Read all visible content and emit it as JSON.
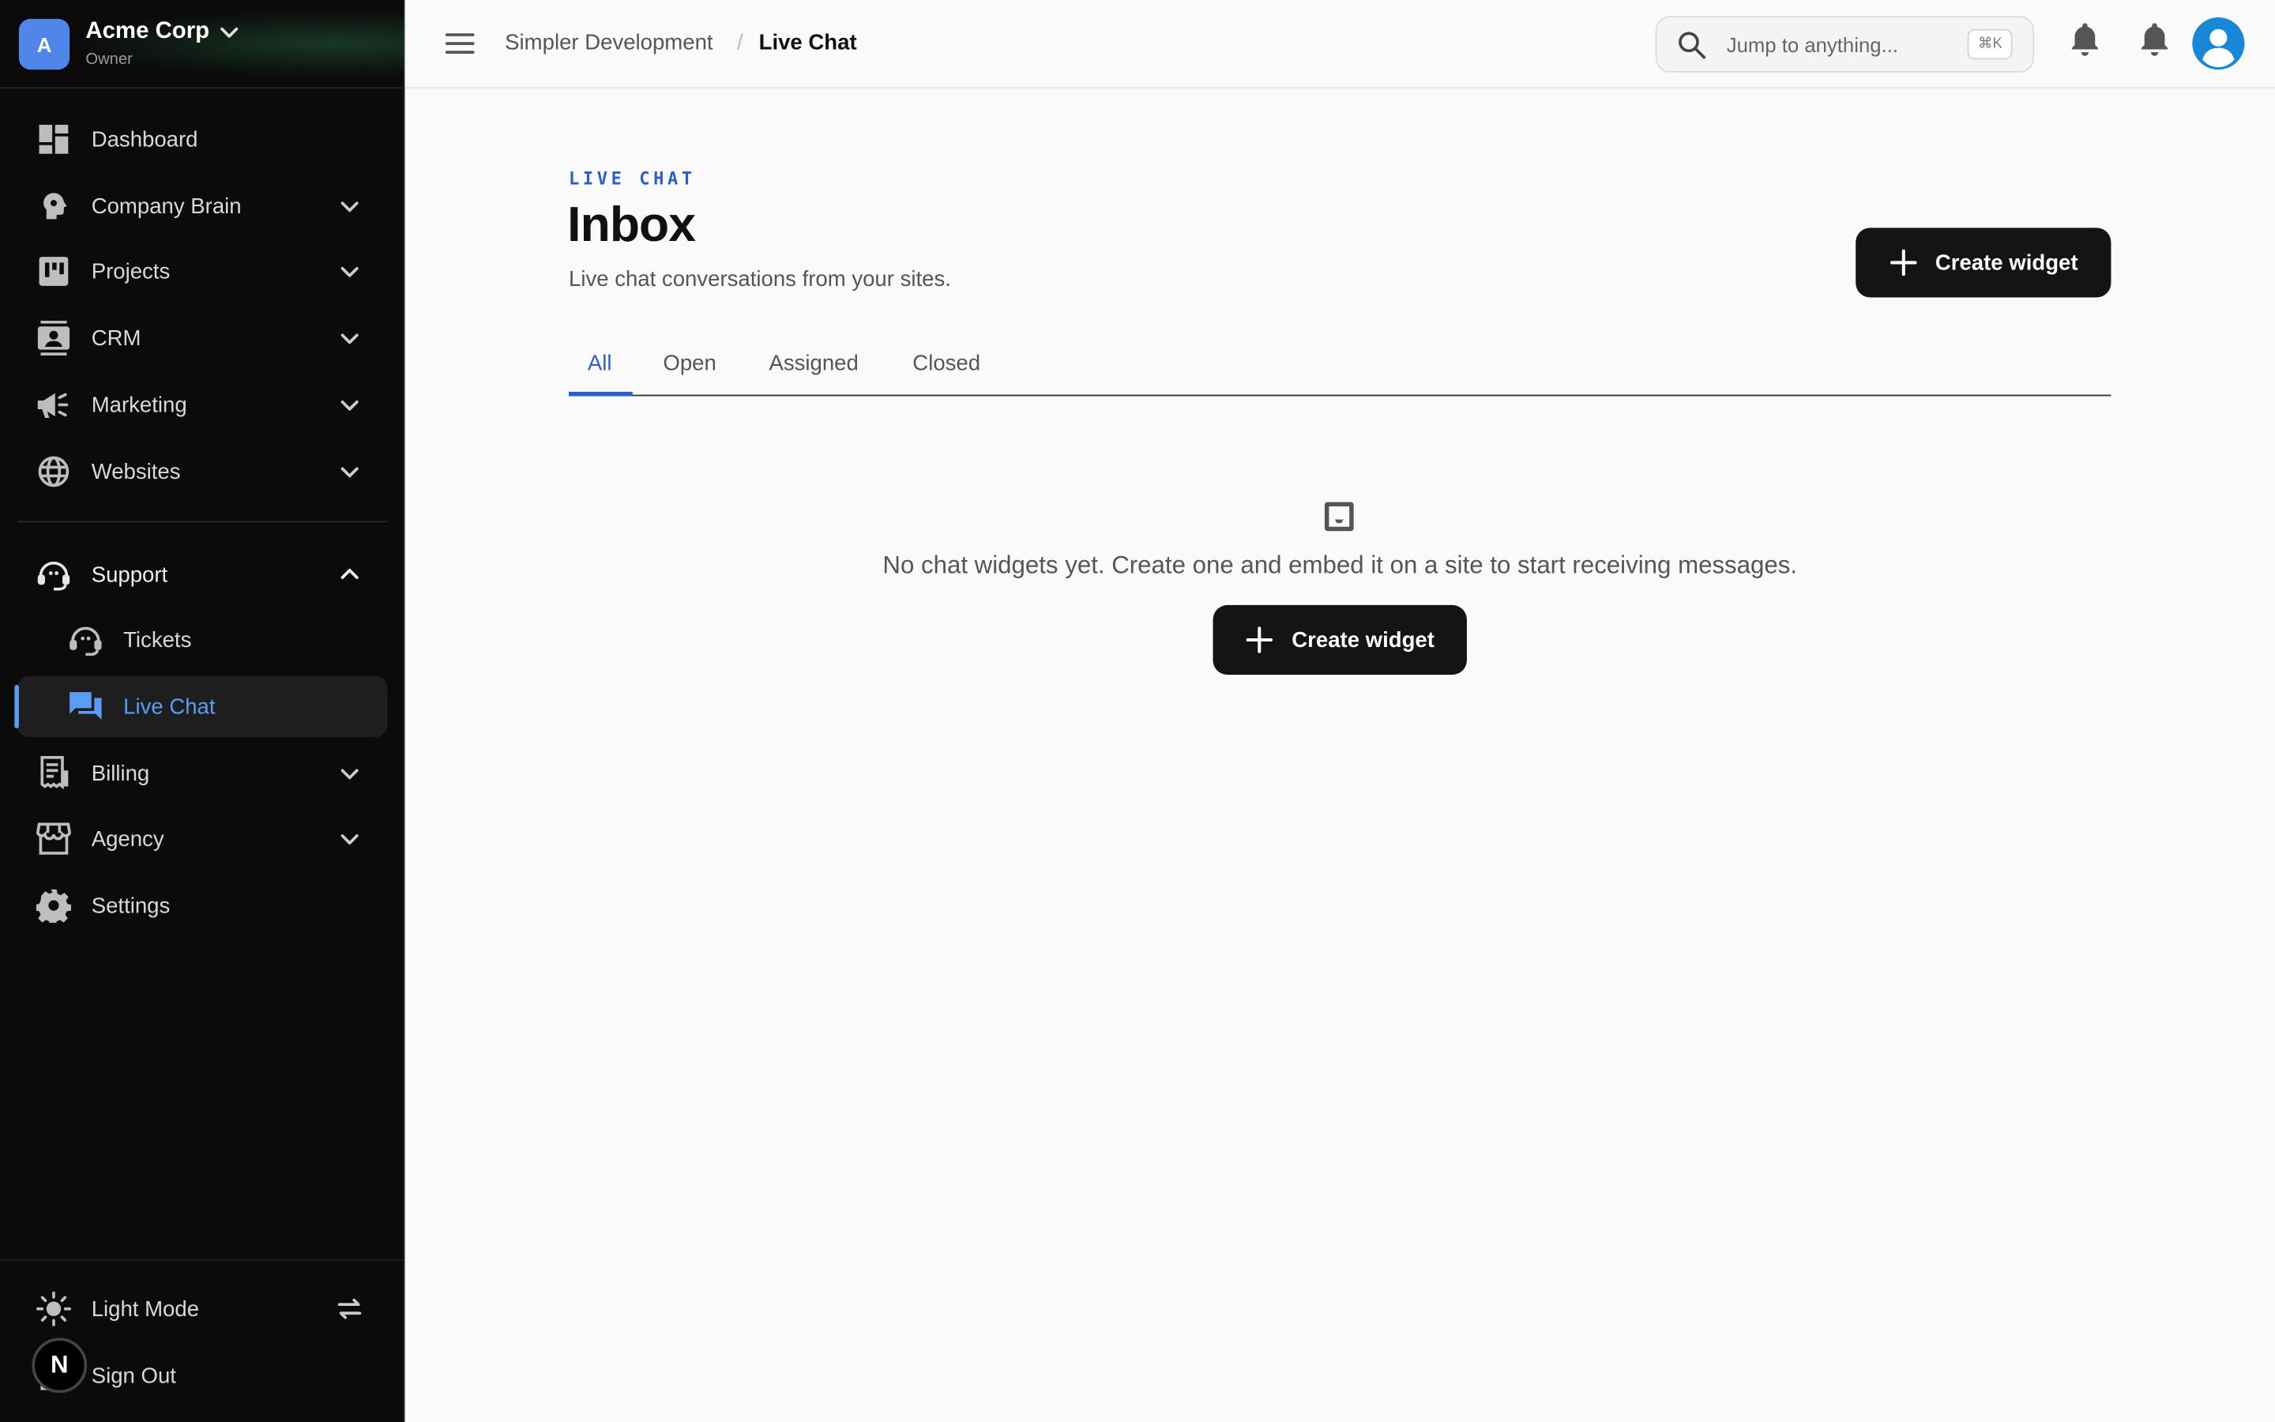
{
  "org": {
    "initial": "A",
    "name": "Acme Corp",
    "role": "Owner"
  },
  "sidebar": {
    "items": [
      {
        "label": "Dashboard",
        "icon": "dashboard-icon"
      },
      {
        "label": "Company Brain",
        "icon": "brain-icon"
      },
      {
        "label": "Projects",
        "icon": "projects-icon"
      },
      {
        "label": "CRM",
        "icon": "contacts-icon"
      },
      {
        "label": "Marketing",
        "icon": "megaphone-icon"
      },
      {
        "label": "Websites",
        "icon": "globe-icon"
      },
      {
        "label": "Support",
        "icon": "headset-icon"
      },
      {
        "label": "Tickets",
        "icon": "headset-icon"
      },
      {
        "label": "Live Chat",
        "icon": "chat-icon"
      },
      {
        "label": "Billing",
        "icon": "receipt-icon"
      },
      {
        "label": "Agency",
        "icon": "storefront-icon"
      },
      {
        "label": "Settings",
        "icon": "gear-icon"
      }
    ],
    "light_mode": "Light Mode",
    "sign_out": "Sign Out",
    "badge": "N"
  },
  "header": {
    "breadcrumb": [
      "Simpler Development",
      "Live Chat"
    ],
    "breadcrumb_sep": "/",
    "search": {
      "placeholder": "Jump to anything...",
      "shortcut": "⌘K"
    }
  },
  "main": {
    "eyebrow": "LIVE CHAT",
    "title": "Inbox",
    "subtitle": "Live chat conversations from your sites.",
    "create_button": "Create widget",
    "tabs": [
      {
        "label": "All",
        "active": true
      },
      {
        "label": "Open",
        "active": false
      },
      {
        "label": "Assigned",
        "active": false
      },
      {
        "label": "Closed",
        "active": false
      }
    ],
    "empty": {
      "message": "No chat widgets yet. Create one and embed it on a site to start receiving messages.",
      "button": "Create widget"
    }
  },
  "colors": {
    "accent": "#2c60c7",
    "sidebar_active": "#5b9cf5",
    "sidebar_bg": "#0b0b0b",
    "button_bg": "#141414"
  }
}
